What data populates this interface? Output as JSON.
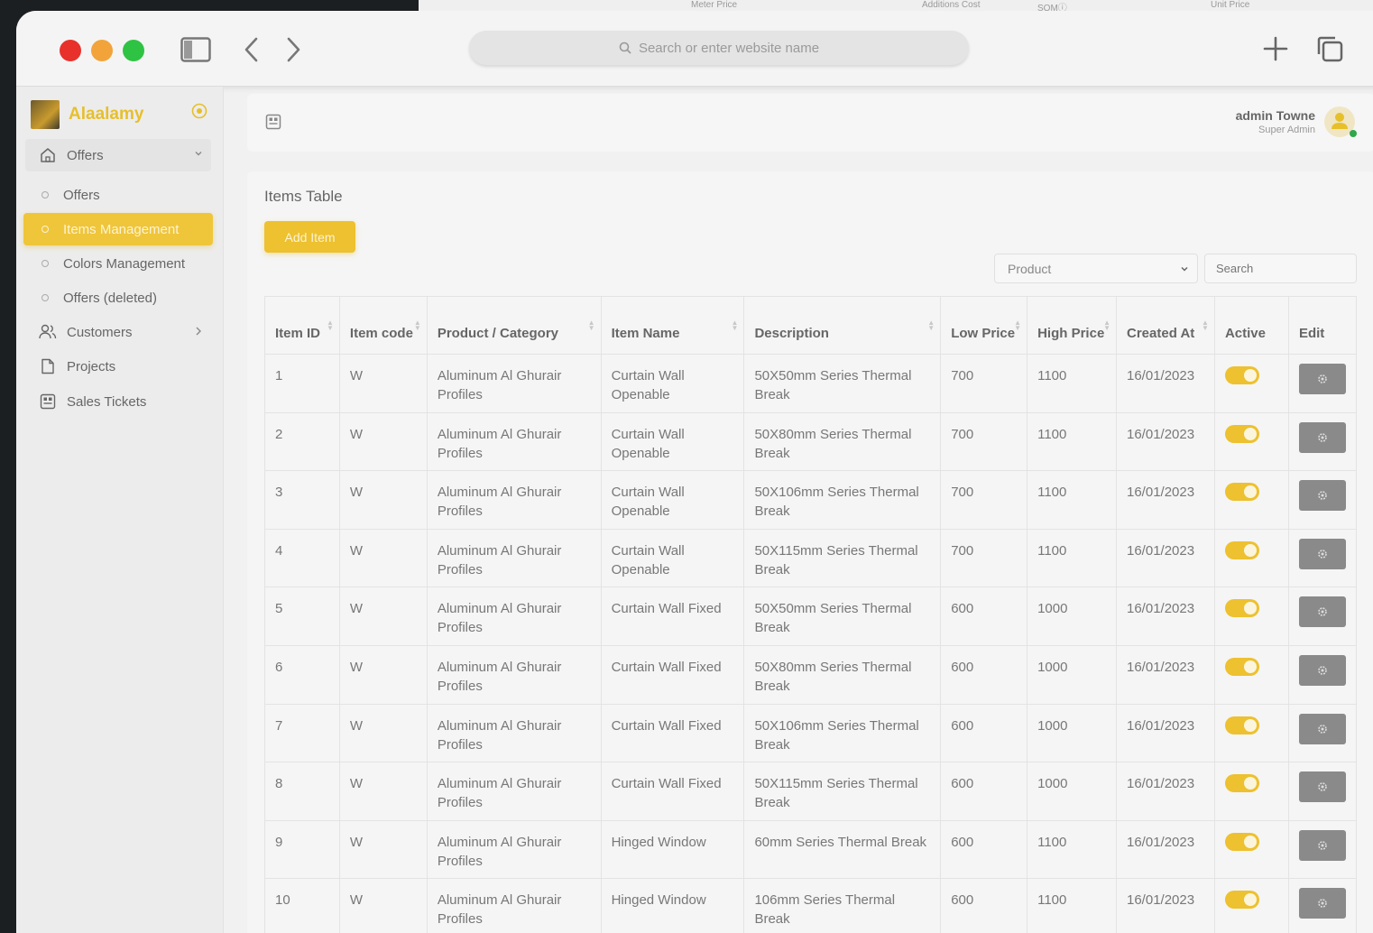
{
  "background_window": {
    "columns": [
      "Meter Price",
      "Additions Cost",
      "SQMⓘ",
      "Unit Price"
    ]
  },
  "browser": {
    "url_placeholder": "Search or enter website name"
  },
  "sidebar": {
    "brand": "Alaalamy",
    "parent_menu": "Offers",
    "items": [
      {
        "label": "Offers"
      },
      {
        "label": "Items Management"
      },
      {
        "label": "Colors Management"
      },
      {
        "label": "Offers (deleted)"
      },
      {
        "label": "Customers"
      },
      {
        "label": "Projects"
      },
      {
        "label": "Sales Tickets"
      }
    ]
  },
  "header": {
    "user_name": "admin Towne",
    "user_role": "Super Admin"
  },
  "main": {
    "title": "Items Table",
    "add_button": "Add Item",
    "filter_select": "Product",
    "search_placeholder": "Search",
    "columns": [
      "Item ID",
      "Item code",
      "Product / Category",
      "Item Name",
      "Description",
      "Low Price",
      "High Price",
      "Created At",
      "Active",
      "Edit"
    ],
    "rows": [
      {
        "id": "1",
        "code": "W",
        "category": "Aluminum Al Ghurair Profiles",
        "name": "Curtain Wall Openable",
        "description": "50X50mm Series Thermal Break",
        "low": "700",
        "high": "1100",
        "created": "16/01/2023",
        "active": true
      },
      {
        "id": "2",
        "code": "W",
        "category": "Aluminum Al Ghurair Profiles",
        "name": "Curtain Wall Openable",
        "description": "50X80mm Series Thermal Break",
        "low": "700",
        "high": "1100",
        "created": "16/01/2023",
        "active": true
      },
      {
        "id": "3",
        "code": "W",
        "category": "Aluminum Al Ghurair Profiles",
        "name": "Curtain Wall Openable",
        "description": "50X106mm Series Thermal Break",
        "low": "700",
        "high": "1100",
        "created": "16/01/2023",
        "active": true
      },
      {
        "id": "4",
        "code": "W",
        "category": "Aluminum Al Ghurair Profiles",
        "name": "Curtain Wall Openable",
        "description": "50X115mm Series Thermal Break",
        "low": "700",
        "high": "1100",
        "created": "16/01/2023",
        "active": true
      },
      {
        "id": "5",
        "code": "W",
        "category": "Aluminum Al Ghurair Profiles",
        "name": "Curtain Wall Fixed",
        "description": "50X50mm Series Thermal Break",
        "low": "600",
        "high": "1000",
        "created": "16/01/2023",
        "active": true
      },
      {
        "id": "6",
        "code": "W",
        "category": "Aluminum Al Ghurair Profiles",
        "name": "Curtain Wall Fixed",
        "description": "50X80mm Series Thermal Break",
        "low": "600",
        "high": "1000",
        "created": "16/01/2023",
        "active": true
      },
      {
        "id": "7",
        "code": "W",
        "category": "Aluminum Al Ghurair Profiles",
        "name": "Curtain Wall Fixed",
        "description": "50X106mm Series Thermal Break",
        "low": "600",
        "high": "1000",
        "created": "16/01/2023",
        "active": true
      },
      {
        "id": "8",
        "code": "W",
        "category": "Aluminum Al Ghurair Profiles",
        "name": "Curtain Wall Fixed",
        "description": "50X115mm Series Thermal Break",
        "low": "600",
        "high": "1000",
        "created": "16/01/2023",
        "active": true
      },
      {
        "id": "9",
        "code": "W",
        "category": "Aluminum Al Ghurair Profiles",
        "name": "Hinged Window",
        "description": "60mm Series Thermal Break",
        "low": "600",
        "high": "1100",
        "created": "16/01/2023",
        "active": true
      },
      {
        "id": "10",
        "code": "W",
        "category": "Aluminum Al Ghurair Profiles",
        "name": "Hinged Window",
        "description": "106mm Series Thermal Break",
        "low": "600",
        "high": "1100",
        "created": "16/01/2023",
        "active": true
      }
    ]
  },
  "colors": {
    "accent": "#edc12f",
    "brand_text": "#e7bf2b",
    "edit_button": "#8a8a8a"
  }
}
